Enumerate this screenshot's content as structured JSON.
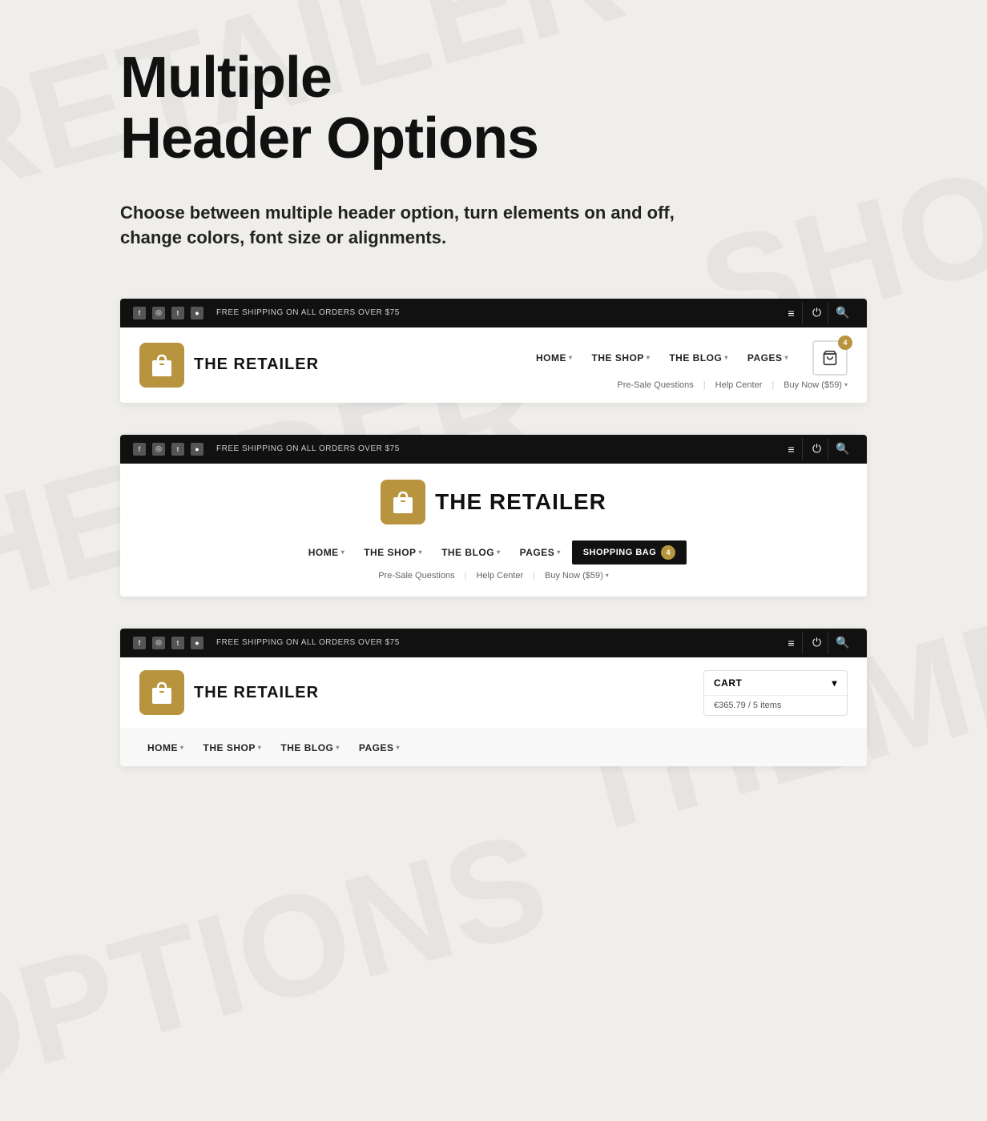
{
  "hero": {
    "title_line1": "Multiple",
    "title_line2": "Header Options",
    "description": "Choose between multiple header option, turn elements on and off, change colors, font size or alignments."
  },
  "topbar": {
    "message": "FREE SHIPPING ON ALL ORDERS OVER $75"
  },
  "header1": {
    "logo_text": "THE RETAILER",
    "nav_items": [
      {
        "label": "HOME",
        "has_chevron": true
      },
      {
        "label": "THE SHOP",
        "has_chevron": true
      },
      {
        "label": "THE BLOG",
        "has_chevron": true
      },
      {
        "label": "PAGES",
        "has_chevron": true
      }
    ],
    "secondary_nav": [
      {
        "label": "Pre-Sale Questions"
      },
      {
        "label": "Help Center"
      },
      {
        "label": "Buy Now ($59)",
        "has_chevron": true
      }
    ],
    "cart_count": "4"
  },
  "header2": {
    "logo_text": "THE RETAILER",
    "nav_items": [
      {
        "label": "HOME",
        "has_chevron": true
      },
      {
        "label": "THE SHOP",
        "has_chevron": true
      },
      {
        "label": "THE BLOG",
        "has_chevron": true
      },
      {
        "label": "PAGES",
        "has_chevron": true
      },
      {
        "label": "SHOPPING BAG",
        "has_chevron": false
      }
    ],
    "bag_count": "4",
    "secondary_nav": [
      {
        "label": "Pre-Sale Questions"
      },
      {
        "label": "Help Center"
      },
      {
        "label": "Buy Now ($59)",
        "has_chevron": true
      }
    ]
  },
  "header3": {
    "logo_text": "THE RETAILER",
    "cart_label": "CART",
    "cart_info": "€365.79 / 5 items",
    "nav_items": [
      {
        "label": "HOME",
        "has_chevron": true
      },
      {
        "label": "THE SHOP",
        "has_chevron": true
      },
      {
        "label": "THE BLOG",
        "has_chevron": true
      },
      {
        "label": "PAGES",
        "has_chevron": true
      }
    ]
  },
  "social_icons": [
    "f",
    "◎",
    "t",
    "●"
  ]
}
